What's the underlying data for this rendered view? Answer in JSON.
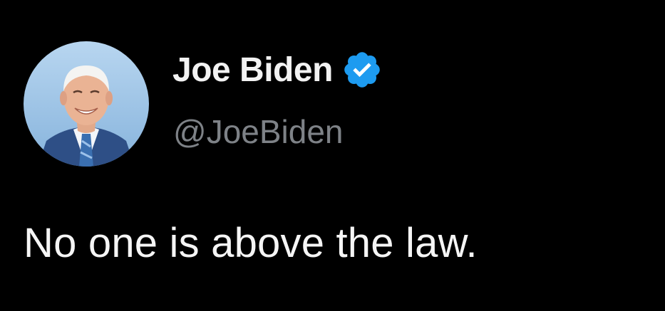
{
  "tweet": {
    "author": {
      "display_name": "Joe Biden",
      "handle": "@JoeBiden",
      "verified": true,
      "avatar_icon": "profile-photo"
    },
    "text": "No one is above the law."
  },
  "colors": {
    "background": "#000000",
    "name": "#f2f2f2",
    "handle": "#7e8287",
    "verified_badge": "#1d9bf0",
    "avatar_bg": "#9ec4e6"
  }
}
